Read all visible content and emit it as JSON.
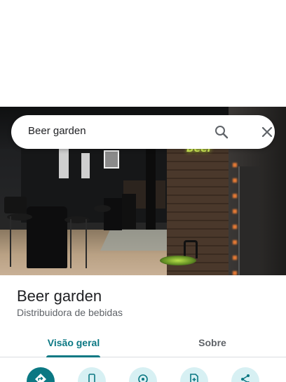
{
  "search": {
    "query": "Beer garden",
    "search_icon": "search-icon",
    "clear_icon": "close-icon"
  },
  "photo": {
    "neon_sign": "Beer"
  },
  "place": {
    "name": "Beer garden",
    "category": "Distribuidora de bebidas"
  },
  "tabs": [
    {
      "label": "Visão geral",
      "active": true
    },
    {
      "label": "Sobre",
      "active": false
    }
  ],
  "actions": [
    {
      "icon": "directions-icon"
    },
    {
      "icon": "phone-icon"
    },
    {
      "icon": "location-icon"
    },
    {
      "icon": "save-icon"
    },
    {
      "icon": "share-icon"
    }
  ],
  "colors": {
    "accent": "#0b7883",
    "action_bg": "#d7f0f3",
    "text_primary": "#202124",
    "text_secondary": "#5f6368"
  }
}
